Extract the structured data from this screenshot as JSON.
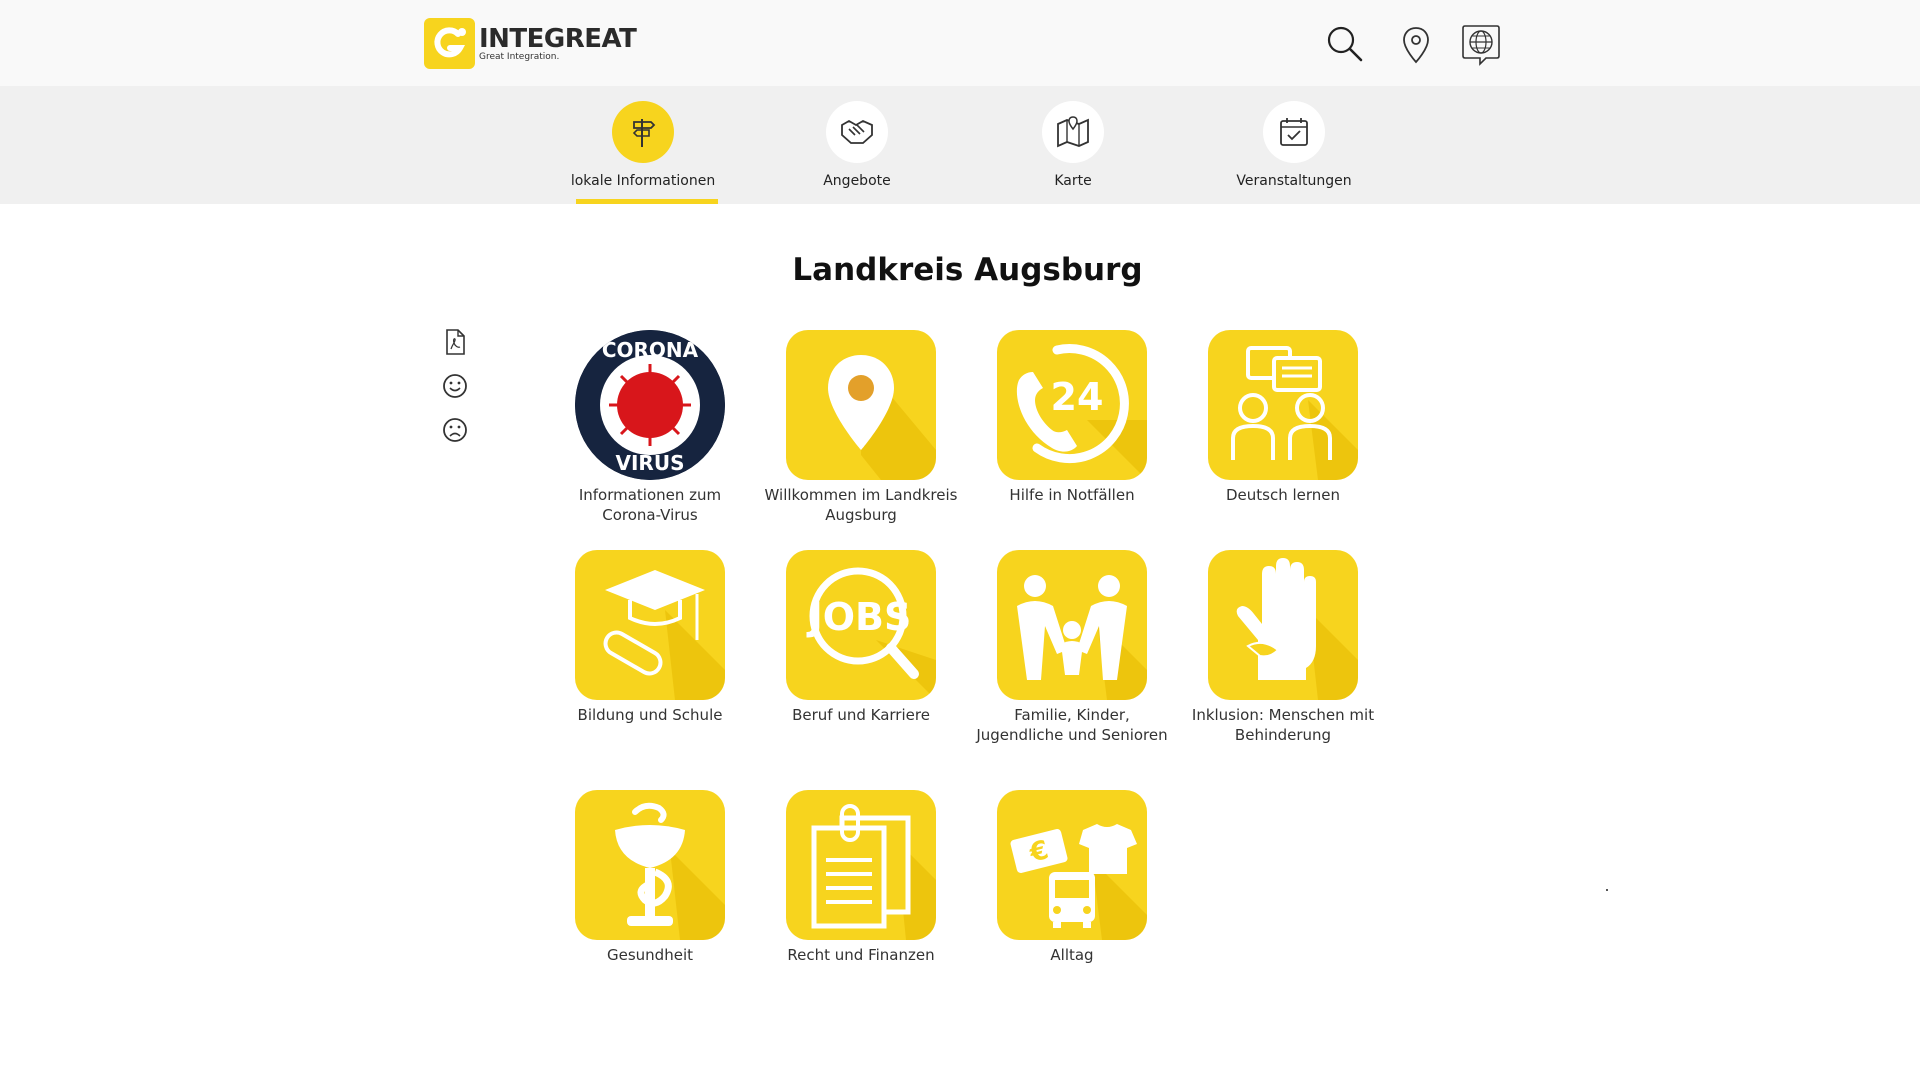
{
  "header": {
    "logo_name": "INTEGREAT",
    "logo_tagline": "Great Integration.",
    "icons": [
      "search-icon",
      "location-pin-icon",
      "language-globe-icon"
    ]
  },
  "tabs": [
    {
      "label": "lokale Informationen",
      "icon": "signpost-icon",
      "active": true
    },
    {
      "label": "Angebote",
      "icon": "handshake-icon",
      "active": false
    },
    {
      "label": "Karte",
      "icon": "map-icon",
      "active": false
    },
    {
      "label": "Veranstaltungen",
      "icon": "calendar-check-icon",
      "active": false
    }
  ],
  "page": {
    "title": "Landkreis Augsburg"
  },
  "side_tools": [
    "pdf-icon",
    "happy-face-icon",
    "sad-face-icon"
  ],
  "corona_badge": {
    "top": "CORONA",
    "bottom": "VIRUS"
  },
  "tiles": [
    {
      "label": "Informationen zum Corona-Virus",
      "icon": "corona-virus-icon"
    },
    {
      "label": "Willkommen im Landkreis Augsburg",
      "icon": "location-pin-icon"
    },
    {
      "label": "Hilfe in Notfällen",
      "icon": "phone-24-icon",
      "badge": "24"
    },
    {
      "label": "Deutsch lernen",
      "icon": "conversation-icon"
    },
    {
      "label": "Bildung und Schule",
      "icon": "graduation-cap-icon"
    },
    {
      "label": "Beruf und Karriere",
      "icon": "jobs-search-icon",
      "badge": "JOBS"
    },
    {
      "label": "Familie, Kinder, Jugendliche und Senioren",
      "icon": "family-icon"
    },
    {
      "label": "Inklusion: Menschen mit Behinderung",
      "icon": "helping-hand-icon"
    },
    {
      "label": "Gesundheit",
      "icon": "health-aesculapius-icon"
    },
    {
      "label": "Recht und Finanzen",
      "icon": "documents-icon"
    },
    {
      "label": "Alltag",
      "icon": "everyday-life-icon",
      "badge": "€"
    }
  ],
  "colors": {
    "accent": "#f7d41e",
    "header_bg": "#f9f9f9",
    "tabbar_bg": "#f0f0f0",
    "corona_navy": "#16243f",
    "corona_red": "#d8161b"
  }
}
